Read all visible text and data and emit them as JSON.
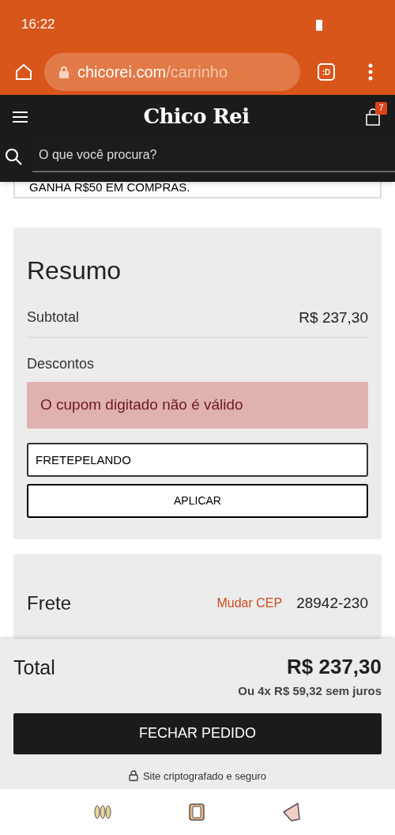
{
  "status_bar": {
    "time": "16:22"
  },
  "browser": {
    "url_domain": "chicorei.com",
    "url_path": "/carrinho",
    "tab_badge": ":D"
  },
  "header": {
    "logo": "Chico Rei",
    "cart_count": "7",
    "search": {
      "placeholder": "O que você procura?"
    }
  },
  "promo": {
    "text": "GANHA R$50 EM COMPRAS."
  },
  "summary": {
    "title": "Resumo",
    "subtotal_label": "Subtotal",
    "subtotal_value": "R$ 237,30",
    "discounts_label": "Descontos",
    "error": "O cupom digitado não é válido",
    "coupon": {
      "value": "FRETEPELANDO"
    },
    "apply_button": "APLICAR"
  },
  "shipping": {
    "title": "Frete",
    "change_link": "Mudar CEP",
    "cep": "28942-230"
  },
  "footer": {
    "total_label": "Total",
    "total_value": "R$ 237,30",
    "installments": "Ou 4x R$ 59,32 sem juros",
    "checkout_button": "FECHAR PEDIDO",
    "secure_note": "Site criptografado e seguro"
  }
}
